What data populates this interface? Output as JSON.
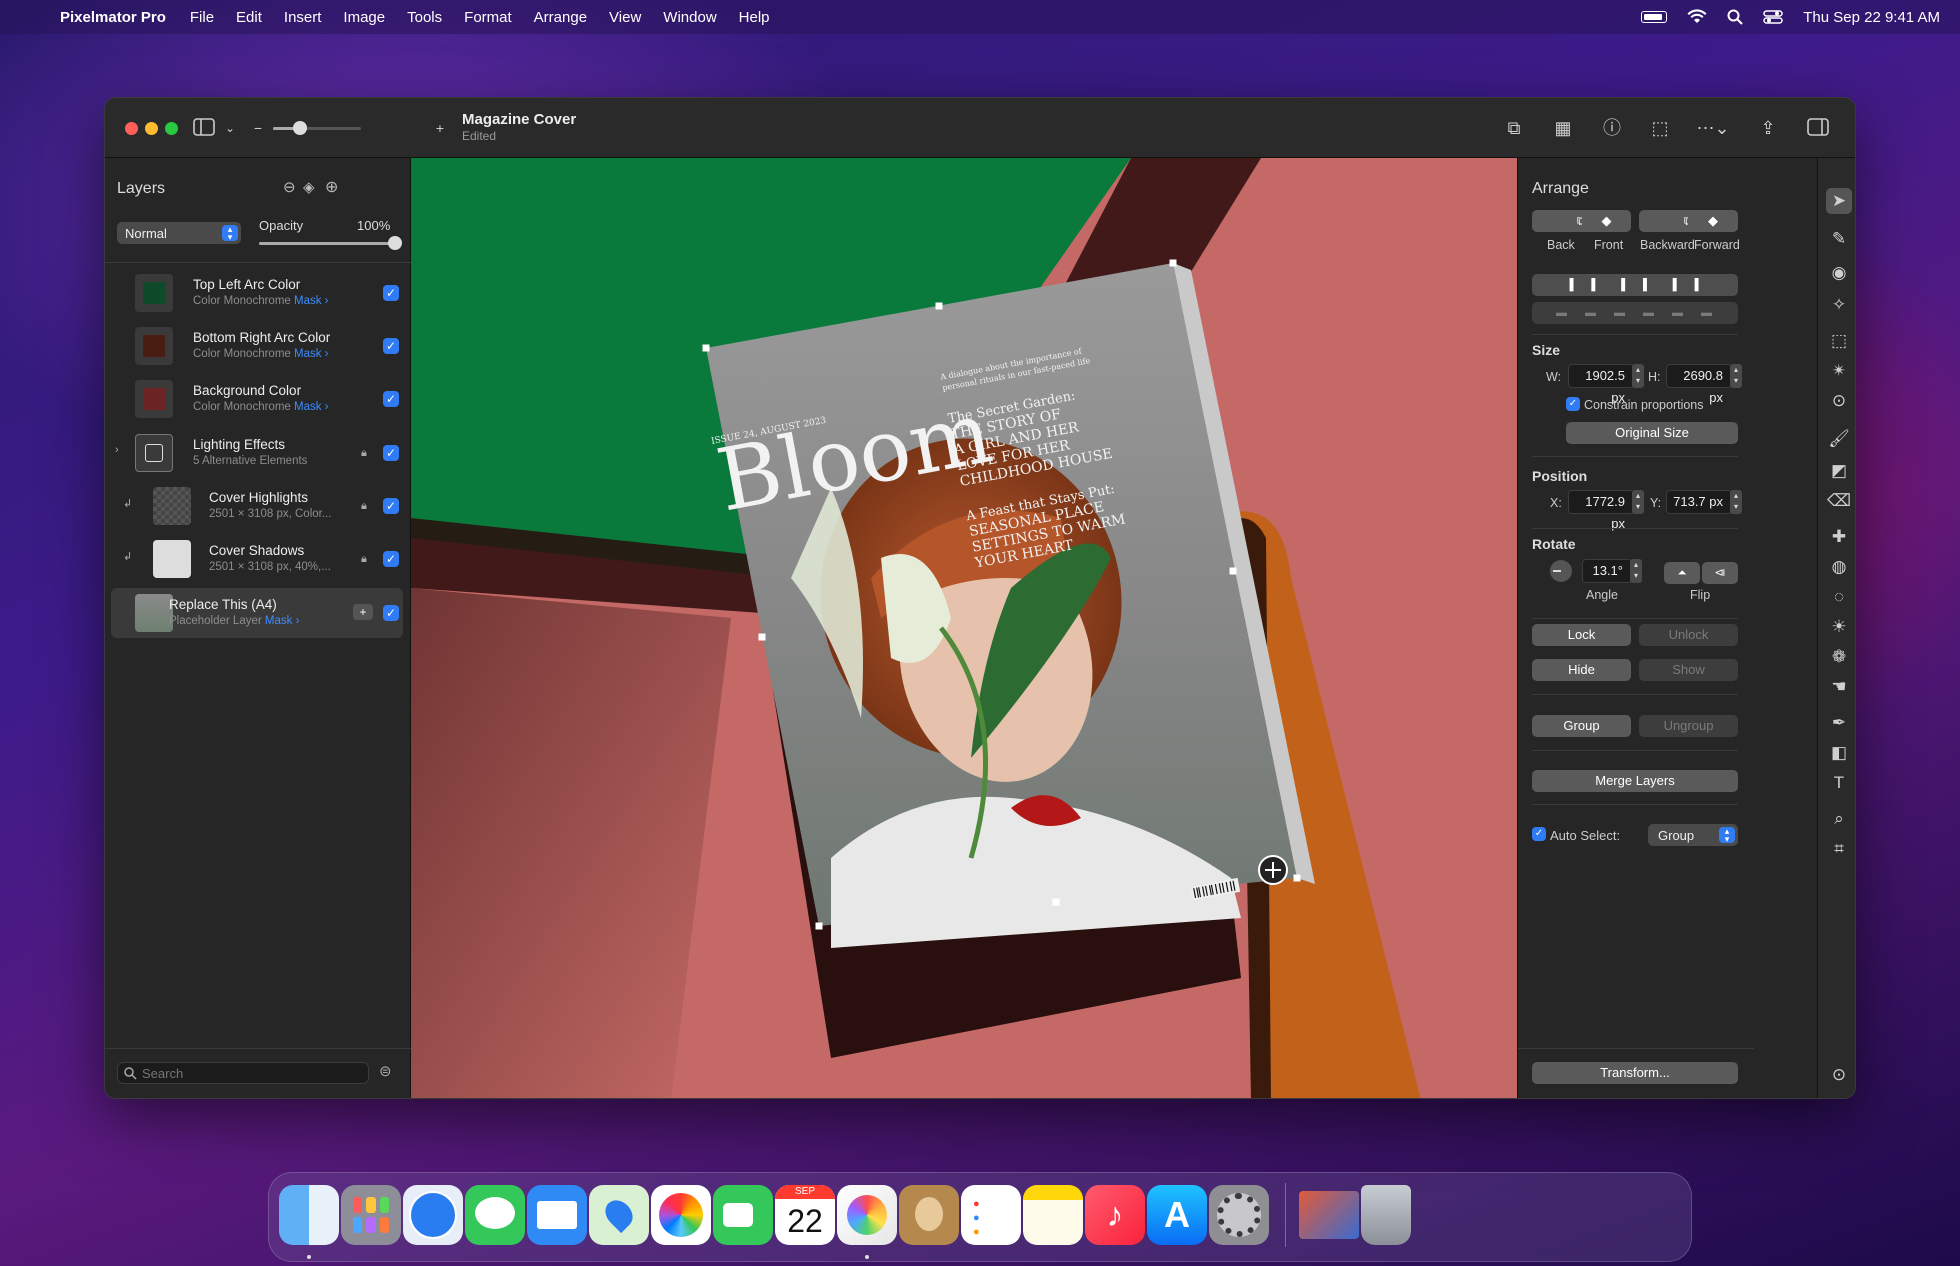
{
  "menubar": {
    "app": "Pixelmator Pro",
    "items": [
      "File",
      "Edit",
      "Insert",
      "Image",
      "Tools",
      "Format",
      "Arrange",
      "View",
      "Window",
      "Help"
    ],
    "clock": "Thu Sep 22  9:41 AM"
  },
  "window": {
    "title": "Magazine Cover",
    "subtitle": "Edited"
  },
  "layers": {
    "title": "Layers",
    "blend": "Normal",
    "opacity_label": "Opacity",
    "opacity_value": "100%",
    "opacity_fraction": 1.0,
    "items": [
      {
        "name": "Top Left Arc Color",
        "sub": "Color Monochrome",
        "mask": "Mask ›",
        "color": "#0f4a2a"
      },
      {
        "name": "Bottom Right Arc Color",
        "sub": "Color Monochrome",
        "mask": "Mask ›",
        "color": "#4a1d12"
      },
      {
        "name": "Background Color",
        "sub": "Color Monochrome",
        "mask": "Mask ›",
        "color": "#6b2324"
      },
      {
        "name": "Lighting Effects",
        "sub": "5 Alternative Elements"
      },
      {
        "name": "Cover Highlights",
        "sub": "2501 × 3108 px, Color..."
      },
      {
        "name": "Cover Shadows",
        "sub": "2501 × 3108 px, 40%,..."
      },
      {
        "name": "Replace This (A4)",
        "sub": "Placeholder Layer",
        "mask": "Mask ›"
      }
    ],
    "search_placeholder": "Search"
  },
  "cover": {
    "issue": "ISSUE 24, AUGUST 2023",
    "tagline1": "A dialogue about the importance of",
    "tagline2": "personal rituals in our fast-paced life",
    "masthead": "Bloom",
    "h1": "The Secret Garden:",
    "h1a": "THE STORY OF",
    "h1b": "A GIRL AND HER",
    "h1c": "LOVE FOR HER",
    "h1d": "CHILDHOOD HOUSE",
    "h2": "A Feast that Stays Put:",
    "h2a": "SEASONAL PLACE",
    "h2b": "SETTINGS TO WARM",
    "h2c": "YOUR HEART"
  },
  "arrange": {
    "title": "Arrange",
    "order": [
      "Back",
      "Front",
      "Backward",
      "Forward"
    ],
    "size_label": "Size",
    "w_label": "W:",
    "w": "1902.5 px",
    "h_label": "H:",
    "h": "2690.8 px",
    "constrain": "Constrain proportions",
    "original_size": "Original Size",
    "position_label": "Position",
    "x_label": "X:",
    "x": "1772.9 px",
    "y_label": "Y:",
    "y": "713.7 px",
    "rotate_label": "Rotate",
    "angle": "13.1°",
    "angle_label": "Angle",
    "flip_label": "Flip",
    "lock": "Lock",
    "unlock": "Unlock",
    "hide": "Hide",
    "show": "Show",
    "group": "Group",
    "ungroup": "Ungroup",
    "merge": "Merge Layers",
    "auto_select": "Auto Select:",
    "auto_select_value": "Group",
    "transform": "Transform..."
  },
  "dock": {
    "calendar_month": "SEP",
    "calendar_day": "22"
  }
}
